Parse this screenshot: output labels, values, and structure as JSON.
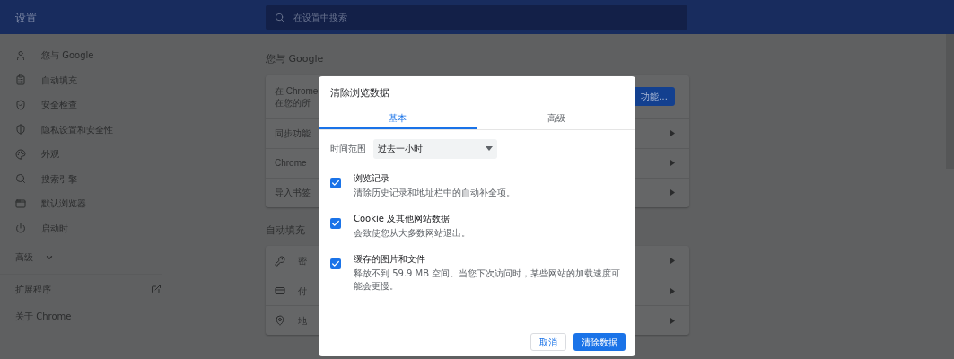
{
  "header": {
    "title": "设置",
    "search_placeholder": "在设置中搜索"
  },
  "sidebar": {
    "items": [
      {
        "label": "您与 Google"
      },
      {
        "label": "自动填充"
      },
      {
        "label": "安全检查"
      },
      {
        "label": "隐私设置和安全性"
      },
      {
        "label": "外观"
      },
      {
        "label": "搜索引擎"
      },
      {
        "label": "默认浏览器"
      },
      {
        "label": "启动时"
      }
    ],
    "advanced": {
      "label": "高级",
      "expanded": false
    },
    "links": [
      {
        "label": "扩展程序",
        "external": true
      },
      {
        "label": "关于 Chrome",
        "external": false
      }
    ]
  },
  "sections": [
    {
      "heading": "您与 Google",
      "rows": [
        {
          "kind": "sync",
          "lines": [
            "在 Chrome",
            "在您的所"
          ],
          "button": "功能…"
        },
        {
          "kind": "link",
          "lines": [
            "同步功能"
          ]
        },
        {
          "kind": "link",
          "lines": [
            "Chrome"
          ]
        },
        {
          "kind": "link",
          "lines": [
            "导入书签"
          ]
        }
      ]
    },
    {
      "heading": "自动填充",
      "rows": [
        {
          "kind": "link",
          "lines": [
            "密"
          ]
        },
        {
          "kind": "link",
          "lines": [
            "付"
          ]
        },
        {
          "kind": "link",
          "lines": [
            "地"
          ]
        }
      ]
    }
  ],
  "dialog": {
    "title": "清除浏览数据",
    "tabs": [
      {
        "label": "基本",
        "selected": true
      },
      {
        "label": "高级",
        "selected": false
      }
    ],
    "time_range": {
      "label": "时间范围",
      "value": "过去一小时"
    },
    "options": [
      {
        "title": "浏览记录",
        "description": "清除历史记录和地址栏中的自动补全项。",
        "checked": true
      },
      {
        "title": "Cookie 及其他网站数据",
        "description": "会致使您从大多数网站退出。",
        "checked": true
      },
      {
        "title": "缓存的图片和文件",
        "description": "释放不到 59.9 MB 空间。当您下次访问时，某些网站的加载速度可能会更慢。",
        "checked": true
      }
    ],
    "buttons": [
      {
        "label": "取消",
        "kind": "secondary"
      },
      {
        "label": "清除数据",
        "kind": "primary"
      }
    ]
  }
}
